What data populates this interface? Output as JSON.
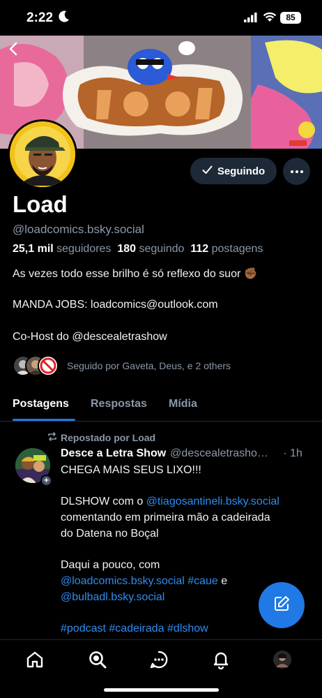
{
  "status_bar": {
    "time": "2:22",
    "battery": "85"
  },
  "profile": {
    "display_name": "Load",
    "handle": "@loadcomics.bsky.social",
    "follow_button_label": "Seguindo",
    "followers_count": "25,1 mil",
    "followers_label": "seguidores",
    "following_count": "180",
    "following_label": "seguindo",
    "posts_count": "112",
    "posts_label": "postagens",
    "bio_line_1": "As vezes todo esse brilho é só reflexo do suor ✊🏾",
    "bio_line_2": "MANDA JOBS: loadcomics@outlook.com",
    "bio_line_3": "Co-Host do @descealetrashow",
    "followed_by": "Seguido por Gaveta, Deus, e 2 others"
  },
  "tabs": [
    {
      "label": "Postagens",
      "active": true
    },
    {
      "label": "Respostas",
      "active": false
    },
    {
      "label": "Mídia",
      "active": false
    }
  ],
  "post": {
    "repost_label": "Repostado por Load",
    "author": "Desce a Letra Show",
    "author_handle": "@descealetrashow.bsky.social",
    "time": "· 1h",
    "line_1": "CHEGA MAIS SEUS LIXO!!!",
    "line_2_pre": "DLSHOW com o ",
    "line_2_link": "@tiagosantineli.bsky.social",
    "line_3": "comentando em primeira mão a cadeirada",
    "line_4": "do Datena no Boçal",
    "line_5": "Daqui a pouco, com",
    "line_6_link_1": "@loadcomics.bsky.social",
    "line_6_link_2": "#caue",
    "line_6_rest": " e",
    "line_7_link": "@bulbadl.bsky.social",
    "line_8_tag_1": "#podcast",
    "line_8_tag_2": "#cadeirada",
    "line_8_tag_3": "#dlshow"
  },
  "bottom_nav": [
    {
      "icon": "home-icon"
    },
    {
      "icon": "search-icon"
    },
    {
      "icon": "chat-icon"
    },
    {
      "icon": "bell-icon"
    },
    {
      "icon": "profile-avatar"
    }
  ],
  "colors": {
    "background": "#000000",
    "accent": "#2079e4",
    "link": "#2e8cf0",
    "muted": "#8a98a8",
    "button_bg": "#1e2937"
  }
}
